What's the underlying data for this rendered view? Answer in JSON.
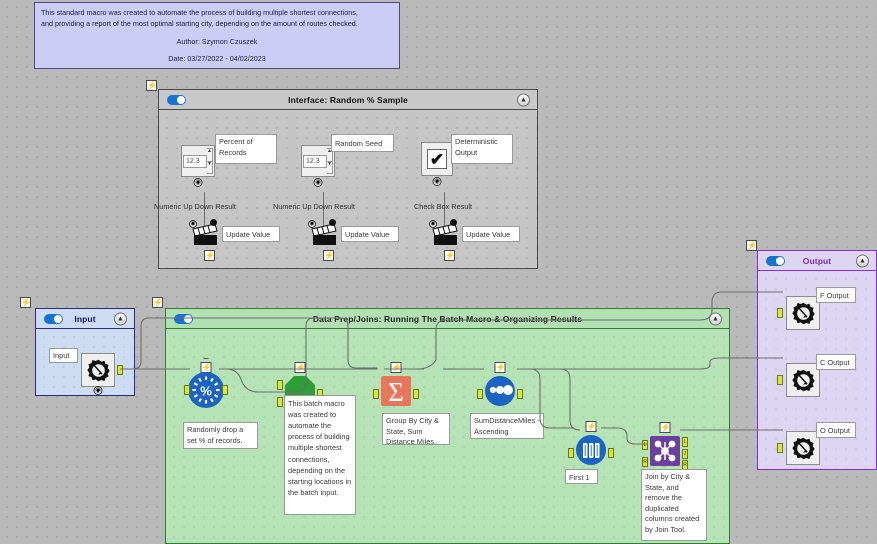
{
  "canvas": {
    "background_color": "#b9b9b9",
    "grid_dot_color": "#8e8e8e"
  },
  "top_comment": {
    "line1": "This standard macro was created to automate the process of building multiple shortest connections,",
    "line2": "and providing a report of the most optimal starting city, depending on the amount of routes checked.",
    "author": "Author: Szymon Czuszek",
    "date": "Date: 03/27/2022 - 04/02/2023",
    "fill_color": "#ccccf5",
    "border_color": "#4a4a8a"
  },
  "interface_container": {
    "title": "Interface: Random % Sample",
    "toggle_on": true,
    "collapse_icon": "chevron-up-icon",
    "header_color": "#c8c8c8",
    "body_color": "#c5c5c5",
    "tools": [
      {
        "id": "percent-of-records",
        "kind": "numeric-up-down",
        "value": "12.3",
        "label": "Percent of Records",
        "result_label": "Numeric Up Down Result",
        "action_label": "Update Value",
        "action_icon": "action-clapperboard-icon"
      },
      {
        "id": "random-seed",
        "kind": "numeric-up-down",
        "value": "12.3",
        "label": "Random Seed",
        "result_label": "Numeric Up Down Result",
        "action_label": "Update Value",
        "action_icon": "action-clapperboard-icon"
      },
      {
        "id": "deterministic-output",
        "kind": "check-box",
        "value": "✔",
        "label": "Deterministic Output",
        "result_label": "Check Box Result",
        "action_label": "Update Value",
        "action_icon": "action-clapperboard-icon"
      }
    ]
  },
  "input_container": {
    "title": "Input",
    "toggle_on": true,
    "collapse_icon": "chevron-up-icon",
    "header_color": "#cddcf0",
    "body_color": "#ccdcf2",
    "border_color": "#2c2c86",
    "title_color": "#111166",
    "tool_label": "Input",
    "tool_icon": "macro-input-gear-icon"
  },
  "data_prep_container": {
    "title": "Data Prep/Joins: Running The Batch Macro & Organizing Results",
    "toggle_on": true,
    "collapse_icon": "chevron-up-icon",
    "header_color": "#b3e0b3",
    "body_color": "#b5e3b5",
    "border_color": "#2e7d32",
    "title_color": "#1f1f1f",
    "tools": [
      {
        "id": "random-percent-sample",
        "icon": "percent-sample-icon",
        "glyph": "%",
        "color": "#1b64c4",
        "note": "Randomly drop a set % of records."
      },
      {
        "id": "batch-macro",
        "icon": "batch-macro-octagon-icon",
        "color": "#2e9e38",
        "note": "This batch macro was created to automate the process of building multiple shortest connections, depending on the starting locations in the batch input."
      },
      {
        "id": "summarize",
        "icon": "summarize-sigma-icon",
        "glyph": "Σ",
        "color": "#e8765a",
        "note": "Group By City & State, Sum Distance Miles."
      },
      {
        "id": "sort",
        "icon": "sort-dots-icon",
        "color": "#1b64c4",
        "note": "SumDistanceMiles - Ascending"
      },
      {
        "id": "sample-first",
        "icon": "sample-bars-icon",
        "color": "#1b64c4",
        "note": "First 1"
      },
      {
        "id": "join",
        "icon": "join-nodes-icon",
        "color": "#6b3fa0",
        "note": "Join by City & State, and remove the duplicated columns created by Join Tool.",
        "ports": [
          "L",
          "J",
          "R"
        ]
      }
    ]
  },
  "output_container": {
    "title": "Output",
    "toggle_on": true,
    "collapse_icon": "chevron-up-icon",
    "header_color": "#ddd6f2",
    "body_color": "#ddd6f2",
    "border_color": "#8a2be2",
    "title_color": "#7b2fbe",
    "outputs": [
      {
        "id": "f-output",
        "label": "F Output",
        "icon": "macro-output-gear-icon"
      },
      {
        "id": "c-output",
        "label": "C Output",
        "icon": "macro-output-gear-icon"
      },
      {
        "id": "o-output",
        "label": "O Output",
        "icon": "macro-output-gear-icon"
      }
    ]
  },
  "anchors": {
    "bolt_glyph": "⚡"
  }
}
